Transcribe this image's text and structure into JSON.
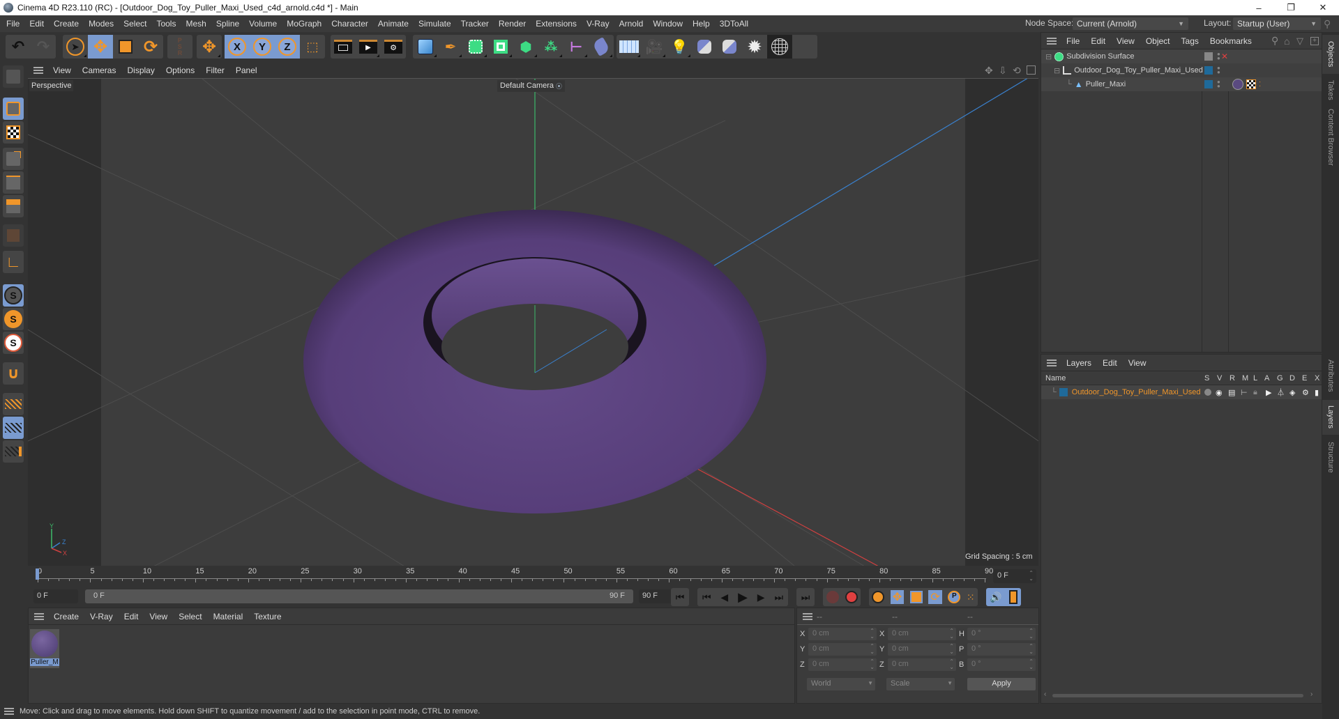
{
  "window": {
    "title": "Cinema 4D R23.110 (RC) - [Outdoor_Dog_Toy_Puller_Maxi_Used_c4d_arnold.c4d *] - Main",
    "minimize": "–",
    "maximize": "❐",
    "close": "✕"
  },
  "menubar": {
    "items": [
      "File",
      "Edit",
      "Create",
      "Modes",
      "Select",
      "Tools",
      "Mesh",
      "Spline",
      "Volume",
      "MoGraph",
      "Character",
      "Animate",
      "Simulate",
      "Tracker",
      "Render",
      "Extensions",
      "V-Ray",
      "Arnold",
      "Window",
      "Help",
      "3DToAll"
    ],
    "node_space_label": "Node Space:",
    "node_space_value": "Current (Arnold)",
    "layout_label": "Layout:",
    "layout_value": "Startup (User)"
  },
  "toolbar": {
    "groups": [
      {
        "name": "history",
        "tools": [
          "undo-icon",
          "redo-icon"
        ]
      },
      {
        "name": "transform",
        "tools": [
          "live-selection-icon",
          "move-icon",
          "scale-icon",
          "rotate-icon"
        ]
      },
      {
        "name": "psr",
        "tools": [
          "psr-icon"
        ]
      },
      {
        "name": "axis-move",
        "tools": [
          "move-axis-icon"
        ]
      },
      {
        "name": "axes",
        "tools": [
          "x-axis-icon",
          "y-axis-icon",
          "z-axis-icon",
          "coordinate-system-icon"
        ]
      },
      {
        "name": "render",
        "tools": [
          "render-view-icon",
          "render-picture-viewer-icon",
          "render-settings-icon"
        ]
      },
      {
        "name": "create",
        "tools": [
          "cube-icon",
          "pen-icon",
          "subdivision-icon",
          "extrude-icon",
          "cloner-icon",
          "mograph-icon",
          "symmetry-icon",
          "deformer-icon"
        ]
      },
      {
        "name": "scene",
        "tools": [
          "floor-icon",
          "camera-icon",
          "light-icon",
          "python-icon",
          "python-generator-icon",
          "explosion-icon",
          "sky-icon"
        ]
      }
    ],
    "xyz": {
      "x": "X",
      "y": "Y",
      "z": "Z"
    }
  },
  "viewport": {
    "menu": [
      "View",
      "Cameras",
      "Display",
      "Options",
      "Filter",
      "Panel"
    ],
    "view_name": "Perspective",
    "camera": "Default Camera",
    "grid_spacing": "Grid Spacing : 5 cm",
    "axis_labels": {
      "x": "X",
      "y": "Y",
      "z": "Z"
    },
    "object_color": "#5a3f7a"
  },
  "timeline": {
    "ticks": [
      "0",
      "5",
      "10",
      "15",
      "20",
      "25",
      "30",
      "35",
      "40",
      "45",
      "50",
      "55",
      "60",
      "65",
      "70",
      "75",
      "80",
      "85",
      "90"
    ],
    "current_frame": "0 F",
    "start_field": "0 F",
    "range_start": "0 F",
    "range_end": "90 F",
    "end_field": "90 F"
  },
  "material_manager": {
    "menu": [
      "Create",
      "V-Ray",
      "Edit",
      "View",
      "Select",
      "Material",
      "Texture"
    ],
    "materials": [
      {
        "name": "Puller_M",
        "color": "#5a4a80"
      }
    ]
  },
  "coordinates": {
    "headers": [
      "--",
      "--",
      "--"
    ],
    "rows": [
      {
        "l1": "X",
        "v1": "0 cm",
        "l2": "X",
        "v2": "0 cm",
        "l3": "H",
        "v3": "0 °"
      },
      {
        "l1": "Y",
        "v1": "0 cm",
        "l2": "Y",
        "v2": "0 cm",
        "l3": "P",
        "v3": "0 °"
      },
      {
        "l1": "Z",
        "v1": "0 cm",
        "l2": "Z",
        "v2": "0 cm",
        "l3": "B",
        "v3": "0 °"
      }
    ],
    "space": "World",
    "mode": "Scale",
    "apply": "Apply"
  },
  "status": "Move: Click and drag to move elements. Hold down SHIFT to quantize movement / add to the selection in point mode, CTRL to remove.",
  "object_manager": {
    "menu": [
      "File",
      "Edit",
      "View",
      "Object",
      "Tags",
      "Bookmarks"
    ],
    "objects": [
      {
        "name": "Subdivision Surface",
        "depth": 0
      },
      {
        "name": "Outdoor_Dog_Toy_Puller_Maxi_Used",
        "depth": 1
      },
      {
        "name": "Puller_Maxi",
        "depth": 2
      }
    ]
  },
  "layer_manager": {
    "menu": [
      "Layers",
      "Edit",
      "View"
    ],
    "columns": [
      "Name",
      "S",
      "V",
      "R",
      "M",
      "L",
      "A",
      "G",
      "D",
      "E",
      "X"
    ],
    "layers": [
      {
        "name": "Outdoor_Dog_Toy_Puller_Maxi_Used",
        "color": "#1f6a9a"
      }
    ]
  },
  "side_tabs": {
    "top": [
      "Objects",
      "Takes",
      "Content Browser"
    ],
    "bottom": [
      "Attributes",
      "Layers",
      "Structure"
    ]
  },
  "colors": {
    "accent_orange": "#f0962a",
    "selection_blue": "#7a9bd0",
    "layer_text": "#f0962a"
  }
}
